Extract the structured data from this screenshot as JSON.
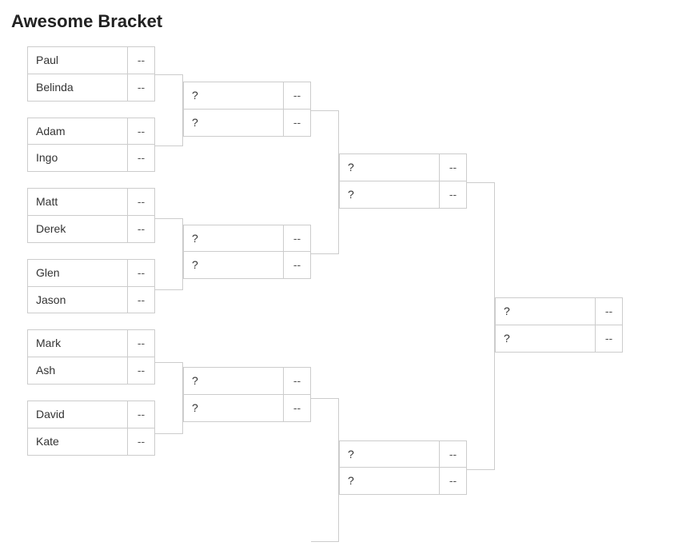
{
  "title": "Awesome Bracket",
  "empty_score": "--",
  "tbd": "?",
  "rounds": [
    {
      "matches": [
        {
          "p1": "Paul",
          "s1": "--",
          "p2": "Belinda",
          "s2": "--"
        },
        {
          "p1": "Adam",
          "s1": "--",
          "p2": "Ingo",
          "s2": "--"
        },
        {
          "p1": "Matt",
          "s1": "--",
          "p2": "Derek",
          "s2": "--"
        },
        {
          "p1": "Glen",
          "s1": "--",
          "p2": "Jason",
          "s2": "--"
        },
        {
          "p1": "Mark",
          "s1": "--",
          "p2": "Ash",
          "s2": "--"
        },
        {
          "p1": "David",
          "s1": "--",
          "p2": "Kate",
          "s2": "--"
        }
      ]
    },
    {
      "matches": [
        {
          "p1": "?",
          "s1": "--",
          "p2": "?",
          "s2": "--"
        },
        {
          "p1": "?",
          "s1": "--",
          "p2": "?",
          "s2": "--"
        },
        {
          "p1": "?",
          "s1": "--",
          "p2": "?",
          "s2": "--"
        }
      ]
    },
    {
      "matches": [
        {
          "p1": "?",
          "s1": "--",
          "p2": "?",
          "s2": "--"
        },
        {
          "p1": "?",
          "s1": "--",
          "p2": "?",
          "s2": "--"
        }
      ]
    },
    {
      "matches": [
        {
          "p1": "?",
          "s1": "--",
          "p2": "?",
          "s2": "--"
        }
      ]
    }
  ]
}
